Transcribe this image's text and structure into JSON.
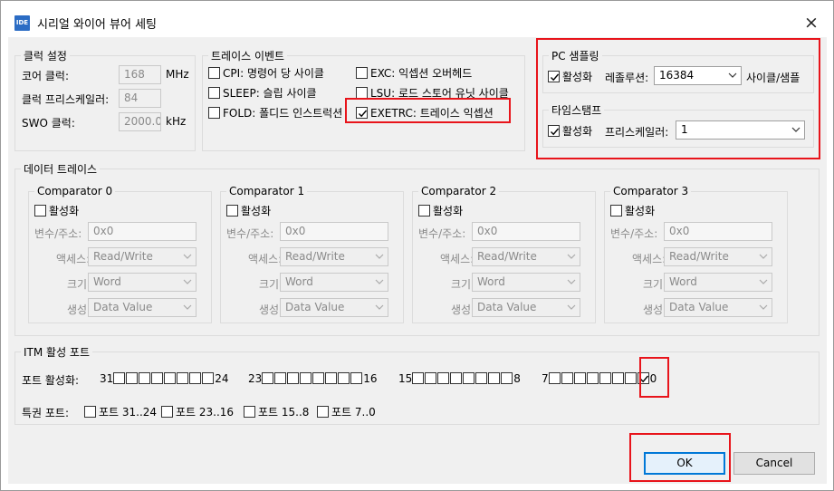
{
  "window": {
    "title": "시리얼 와이어 뷰어 세팅",
    "icon_label": "IDE",
    "close_glyph": "×"
  },
  "clock": {
    "legend": "클럭 설정",
    "core_label": "코어 클럭:",
    "core_value": "168",
    "core_unit": "MHz",
    "prescaler_label": "클럭 프리스케일러:",
    "prescaler_value": "84",
    "swo_label": "SWO 클럭:",
    "swo_value": "2000.0",
    "swo_unit": "kHz"
  },
  "trace_events": {
    "legend": "트레이스 이벤트",
    "items": [
      {
        "label": "CPI: 명령어 당 사이클",
        "checked": false
      },
      {
        "label": "SLEEP: 슬립 사이클",
        "checked": false
      },
      {
        "label": "FOLD: 폴디드 인스트럭션",
        "checked": false
      },
      {
        "label": "EXC: 익셉션 오버헤드",
        "checked": false
      },
      {
        "label": "LSU: 로드 스토어 유닛 사이클",
        "checked": false
      },
      {
        "label": "EXETRC: 트레이스 익셉션",
        "checked": true
      }
    ]
  },
  "pc_sampling": {
    "legend": "PC 샘플링",
    "enable_label": "활성화",
    "enabled": true,
    "resolution_label": "레졸루션:",
    "resolution_value": "16384",
    "unit_label": "사이클/샘플"
  },
  "timestamp": {
    "legend": "타임스탬프",
    "enable_label": "활성화",
    "enabled": true,
    "prescaler_label": "프리스케일러:",
    "prescaler_value": "1"
  },
  "data_trace": {
    "legend": "데이터 트레이스",
    "comparators": [
      {
        "title": "Comparator 0",
        "enable_label": "활성화",
        "var_label": "변수/주소:",
        "var_value": "0x0",
        "access_label": "액세스:",
        "access_value": "Read/Write",
        "size_label": "크기:",
        "size_value": "Word",
        "gen_label": "생성:",
        "gen_value": "Data Value"
      },
      {
        "title": "Comparator 1",
        "enable_label": "활성화",
        "var_label": "변수/주소:",
        "var_value": "0x0",
        "access_label": "액세스:",
        "access_value": "Read/Write",
        "size_label": "크기:",
        "size_value": "Word",
        "gen_label": "생성:",
        "gen_value": "Data Value"
      },
      {
        "title": "Comparator 2",
        "enable_label": "활성화",
        "var_label": "변수/주소:",
        "var_value": "0x0",
        "access_label": "액세스:",
        "access_value": "Read/Write",
        "size_label": "크기:",
        "size_value": "Word",
        "gen_label": "생성:",
        "gen_value": "Data Value"
      },
      {
        "title": "Comparator 3",
        "enable_label": "활성화",
        "var_label": "변수/주소:",
        "var_value": "0x0",
        "access_label": "액세스:",
        "access_value": "Read/Write",
        "size_label": "크기:",
        "size_value": "Word",
        "gen_label": "생성:",
        "gen_value": "Data Value"
      }
    ]
  },
  "itm": {
    "legend": "ITM 활성 포트",
    "ports_label": "포트 활성화:",
    "groups": [
      {
        "start": "31",
        "end": "24"
      },
      {
        "start": "23",
        "end": "16"
      },
      {
        "start": "15",
        "end": "8"
      },
      {
        "start": "7",
        "end": "0"
      }
    ],
    "port0_checked": true,
    "priv_label": "특권 포트:",
    "priv_ports": [
      "포트 31..24",
      "포트 23..16",
      "포트 15..8",
      "포트 7..0"
    ]
  },
  "buttons": {
    "ok": "OK",
    "cancel": "Cancel"
  },
  "colors": {
    "highlight": "#e8141b",
    "accent": "#0078d7"
  }
}
